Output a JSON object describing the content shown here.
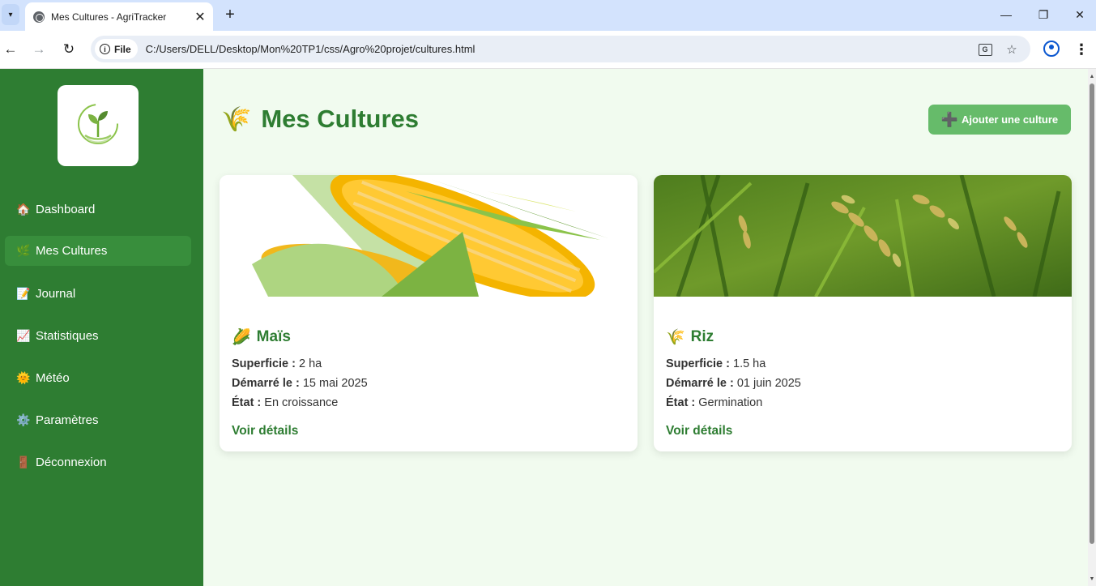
{
  "browser": {
    "tab_title": "Mes Cultures - AgriTracker",
    "chip_label": "File",
    "url": "C:/Users/DELL/Desktop/Mon%20TP1/css/Agro%20projet/cultures.html"
  },
  "sidebar": {
    "items": [
      {
        "icon": "🏠",
        "label": "Dashboard"
      },
      {
        "icon": "🌿",
        "label": "Mes Cultures"
      },
      {
        "icon": "📝",
        "label": "Journal"
      },
      {
        "icon": "📈",
        "label": "Statistiques"
      },
      {
        "icon": "🌞",
        "label": "Météo"
      },
      {
        "icon": "⚙️",
        "label": "Paramètres"
      },
      {
        "icon": "🚪",
        "label": "Déconnexion"
      }
    ],
    "active_index": 1
  },
  "header": {
    "title_icon": "🌾",
    "title": "Mes Cultures",
    "add_button": {
      "icon": "➕",
      "label": "Ajouter une culture"
    }
  },
  "cards": [
    {
      "icon": "🌽",
      "name": "Maïs",
      "superficie_label": "Superficie :",
      "superficie": "2 ha",
      "start_label": "Démarré le :",
      "start": "15 mai 2025",
      "state_label": "État :",
      "state": "En croissance",
      "link": "Voir détails"
    },
    {
      "icon": "🌾",
      "name": "Riz",
      "superficie_label": "Superficie :",
      "superficie": "1.5 ha",
      "start_label": "Démarré le :",
      "start": "01 juin 2025",
      "state_label": "État :",
      "state": "Germination",
      "link": "Voir détails"
    }
  ],
  "colors": {
    "sidebar": "#2e7d32",
    "active_item": "#388e3c",
    "main_bg": "#f1fbef",
    "accent": "#2e7d32",
    "button": "#66bb6a"
  }
}
